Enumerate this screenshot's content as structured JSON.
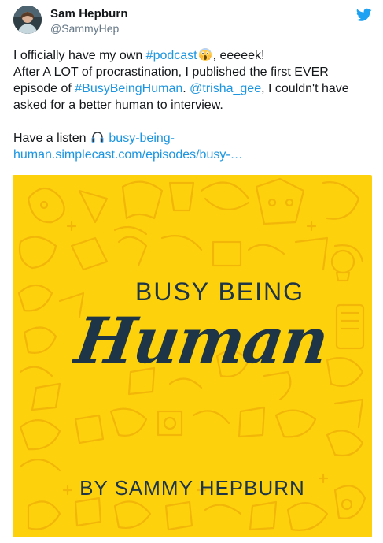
{
  "author": {
    "name": "Sam Hepburn",
    "handle": "@SammyHep"
  },
  "tweet": {
    "line1_pre": "I officially have my own ",
    "hashtag_podcast": "#podcast",
    "line1_post": ", eeeeek!",
    "line2": "After A LOT of procrastination, I published the first EVER",
    "line3_pre": "episode of ",
    "hashtag_busy": "#BusyBeingHuman",
    "line3_mid": ". ",
    "mention": "@trisha_gee",
    "line3_post": ", I couldn't have",
    "line4": "asked for a better human to interview.",
    "listen_pre": "Have a listen",
    "link_part1": "busy-being-",
    "link_part2": "human.simplecast.com/episodes/busy-…"
  },
  "media": {
    "title_top": "BUSY BEING",
    "title_script": "Human",
    "byline": "BY SAMMY HEPBURN"
  },
  "icons": {
    "bird": "twitter-bird-icon",
    "scream_emoji": "face-screaming-emoji",
    "headphone_emoji": "headphone-emoji"
  },
  "colors": {
    "link": "#1b95e0",
    "twitter_blue": "#1da1f2",
    "cover_yellow": "#fdd10c",
    "cover_ink": "#1d3547",
    "handle_gray": "#657786"
  }
}
